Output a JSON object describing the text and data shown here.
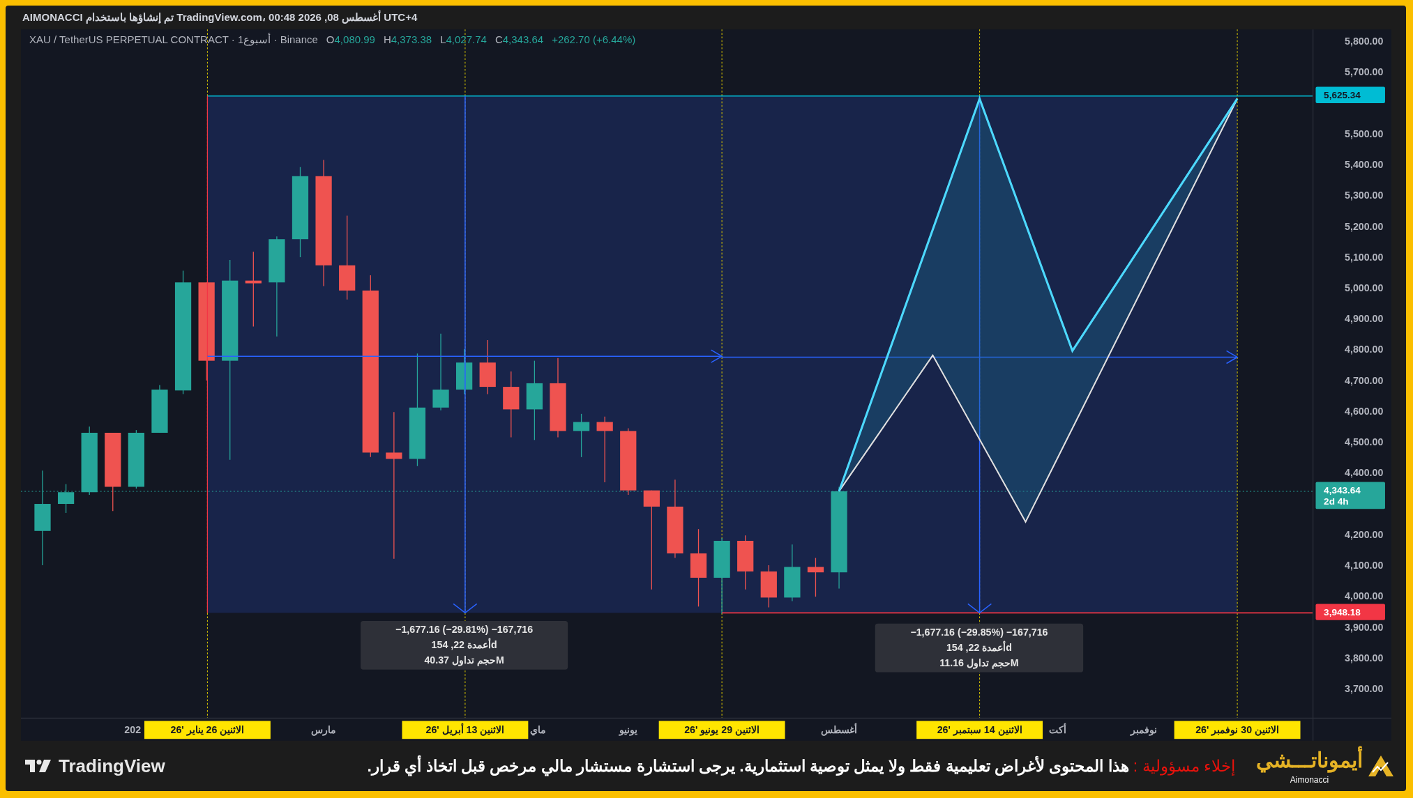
{
  "header": {
    "text": "AIMONACCI تم إنشاؤها باستخدام TradingView.com، 00:48 2026 ,08 أغسطس UTC+4"
  },
  "symbol": {
    "name": "XAU / TetherUS PERPETUAL CONTRACT · 1أسبوع · Binance",
    "ohlc": [
      {
        "letter": "C",
        "value": "4,343.64"
      },
      {
        "letter": "L",
        "value": "4,027.74"
      },
      {
        "letter": "H",
        "value": "4,373.38"
      },
      {
        "letter": "O",
        "value": "4,080.99"
      }
    ],
    "change": "+262.70 (+6.44%)"
  },
  "price_axis": {
    "ticks": [
      "5,800.00",
      "5,700.00",
      "5,500.00",
      "5,400.00",
      "5,300.00",
      "5,200.00",
      "5,100.00",
      "5,000.00",
      "4,900.00",
      "4,800.00",
      "4,700.00",
      "4,600.00",
      "4,500.00",
      "4,400.00",
      "4,200.00",
      "4,100.00",
      "4,000.00",
      "3,900.00",
      "3,800.00",
      "3,700.00"
    ],
    "badges": [
      {
        "kind": "target",
        "text": "5,625.34"
      },
      {
        "kind": "last",
        "text": "4,343.64",
        "sub": "2d 4h"
      },
      {
        "kind": "stop",
        "text": "3,948.18"
      }
    ]
  },
  "measures": [
    {
      "lines": [
        "−1,677.16 (−29.85%) −167,716",
        "أعمدة 22, 154d",
        "حجم تداول 11.16M"
      ]
    },
    {
      "lines": [
        "−1,677.16 (−29.81%) −167,716",
        "أعمدة 22, 154d",
        "حجم تداول 40.37M"
      ]
    }
  ],
  "time_axis": {
    "labels": [
      "نوفمبر",
      "أكت",
      "أغسطس",
      "يونيو",
      "ماي",
      "مارس",
      "202"
    ],
    "markers": [
      "الاثنين 30 نوفمبر '26",
      "الاثنين 14 سبتمبر '26",
      "الاثنين 29 يونيو '26",
      "الاثنين 13 أبريل '26",
      "الاثنين 26 يناير '26"
    ]
  },
  "banner": {
    "brand": "TradingView",
    "disclaimer_label": "إخلاء مسؤولية :",
    "disclaimer": "هذا المحتوى لأغراض تعليمية فقط ولا يمثل توصية استثمارية. يرجى استشارة مستشار مالي مرخص قبل اتخاذ أي قرار.",
    "logo": "أيموناتـــشي",
    "logo_latin": "Aimonacci"
  }
}
